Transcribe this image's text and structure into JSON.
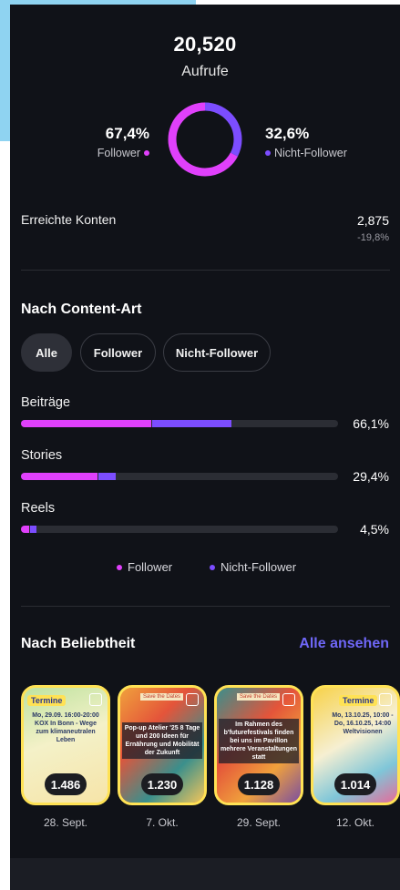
{
  "summary": {
    "total": "20,520",
    "total_label": "Aufrufe",
    "follower_pct": "67,4%",
    "follower_label": "Follower",
    "nonfollower_pct": "32,6%",
    "nonfollower_label": "Nicht-Follower",
    "follower_share": 0.674,
    "nonfollower_share": 0.326
  },
  "reach": {
    "label": "Erreichte Konten",
    "value": "2,875",
    "delta": "-19,8%"
  },
  "content_type": {
    "title": "Nach Content-Art",
    "filters": [
      "Alle",
      "Follower",
      "Nicht-Follower"
    ],
    "active_filter": "Alle",
    "rows": [
      {
        "label": "Beiträge",
        "pct": "66,1%",
        "follower": 0.41,
        "nonfollower": 0.25
      },
      {
        "label": "Stories",
        "pct": "29,4%",
        "follower": 0.24,
        "nonfollower": 0.055
      },
      {
        "label": "Reels",
        "pct": "4,5%",
        "follower": 0.025,
        "nonfollower": 0.02
      }
    ],
    "legend": [
      "Follower",
      "Nicht-Follower"
    ]
  },
  "popular": {
    "title": "Nach Beliebtheit",
    "see_all": "Alle ansehen",
    "items": [
      {
        "count": "1.486",
        "date": "28. Sept.",
        "tag": "Termine",
        "caption": "Mo, 29.09. 16:00-20:00  KOX In Bonn - Wege zum klimaneutralen Leben"
      },
      {
        "count": "1.230",
        "date": "7. Okt.",
        "tag": "Save the Dates",
        "caption": "Pop-up Atelier '25  8 Tage und 200 Ideen für Ernährung und Mobilität der Zukunft"
      },
      {
        "count": "1.128",
        "date": "29. Sept.",
        "tag": "Save the Dates",
        "caption": "Im Rahmen des b'futurefestivals finden bei uns im Pavillon mehrere Veranstaltungen statt"
      },
      {
        "count": "1.014",
        "date": "12. Okt.",
        "tag": "Termine",
        "caption": "Mo, 13.10.25, 10:00 - Do, 16.10.25, 14:00  Weltvisionen"
      }
    ]
  },
  "colors": {
    "follower": "#e040fb",
    "nonfollower": "#7c4dff",
    "accent_link": "#6f67f7",
    "panel": "#101218"
  }
}
